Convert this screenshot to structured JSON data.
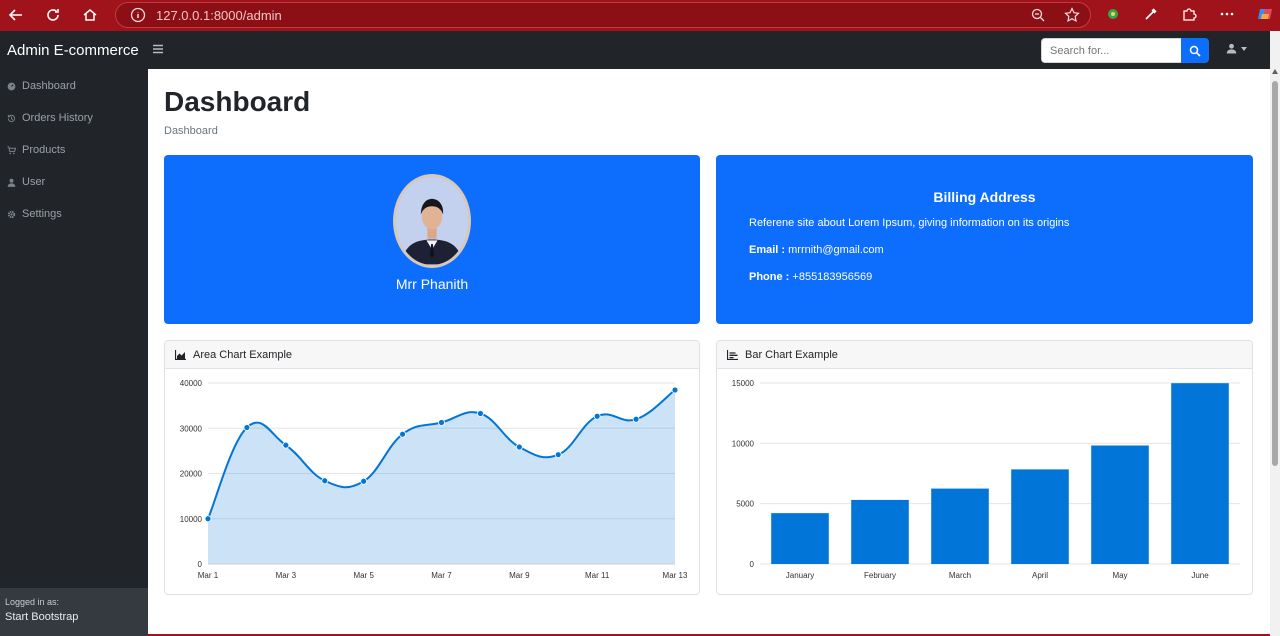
{
  "browser": {
    "url_host": "127.0.0.1",
    "url_rest": ":8000/admin"
  },
  "navbar": {
    "brand": "Admin E-commerce",
    "search_placeholder": "Search for..."
  },
  "sidebar": {
    "items": [
      {
        "label": "Dashboard",
        "icon": "gauge-icon"
      },
      {
        "label": "Orders History",
        "icon": "history-icon"
      },
      {
        "label": "Products",
        "icon": "cart-icon"
      },
      {
        "label": "User",
        "icon": "user-icon"
      },
      {
        "label": "Settings",
        "icon": "gear-icon"
      }
    ],
    "footer_small": "Logged in as:",
    "footer_big": "Start Bootstrap"
  },
  "main": {
    "title": "Dashboard",
    "breadcrumb": "Dashboard"
  },
  "profile": {
    "name": "Mrr Phanith"
  },
  "billing": {
    "title": "Billing Address",
    "description": "Referene site about Lorem Ipsum, giving information on its origins",
    "email_label": "Email :",
    "email": "mrrnith@gmail.com",
    "phone_label": "Phone :",
    "phone": "+855183956569"
  },
  "colors": {
    "brand_blue": "#0d6efd",
    "chart_blue": "#0275d8",
    "dark": "#212529"
  },
  "chart_data": [
    {
      "type": "area",
      "title": "Area Chart Example",
      "x": [
        "Mar 1",
        "Mar 2",
        "Mar 3",
        "Mar 4",
        "Mar 5",
        "Mar 6",
        "Mar 7",
        "Mar 8",
        "Mar 9",
        "Mar 10",
        "Mar 11",
        "Mar 12",
        "Mar 13"
      ],
      "x_tick_labels": [
        "Mar 1",
        "Mar 3",
        "Mar 5",
        "Mar 7",
        "Mar 9",
        "Mar 11",
        "Mar 13"
      ],
      "values": [
        10000,
        30162,
        26263,
        18394,
        18287,
        28682,
        31274,
        33259,
        25849,
        24159,
        32651,
        31984,
        38451
      ],
      "ylim": [
        0,
        40000
      ],
      "y_ticks": [
        0,
        10000,
        20000,
        30000,
        40000
      ],
      "grid": true
    },
    {
      "type": "bar",
      "title": "Bar Chart Example",
      "categories": [
        "January",
        "February",
        "March",
        "April",
        "May",
        "June"
      ],
      "values": [
        4215,
        5312,
        6251,
        7841,
        9821,
        14984
      ],
      "ylim": [
        0,
        15000
      ],
      "y_ticks": [
        0,
        5000,
        10000,
        15000
      ],
      "grid": true
    }
  ]
}
